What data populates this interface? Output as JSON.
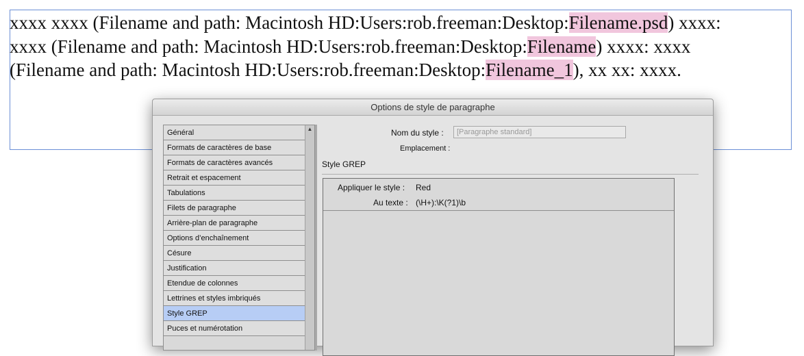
{
  "document": {
    "line1": {
      "text_before": "xxxx xxxx (Filename and path: Macintosh HD:Users:rob.freeman:Desktop:",
      "highlight": "Filename.psd",
      "text_after": ") xxxx:"
    },
    "line2": {
      "text_before": "xxxx (Filename and path: Macintosh HD:Users:rob.freeman:Desktop:",
      "highlight": "Filename",
      "text_after": ") xxxx: xxxx"
    },
    "line3": {
      "text_before": "(Filename and path: Macintosh HD:Users:rob.freeman:Desktop:",
      "highlight": "Filename_1",
      "text_after": "), xx xx: xxxx."
    },
    "highlight_color": "#f1c6dd",
    "frame_color": "#6b8fd6"
  },
  "dialog": {
    "title": "Options de style de paragraphe",
    "categories": [
      {
        "label": "Général"
      },
      {
        "label": "Formats de caractères de base"
      },
      {
        "label": "Formats de caractères avancés"
      },
      {
        "label": "Retrait et espacement"
      },
      {
        "label": "Tabulations"
      },
      {
        "label": "Filets de paragraphe"
      },
      {
        "label": "Arrière-plan de paragraphe"
      },
      {
        "label": "Options d’enchaînement"
      },
      {
        "label": "Césure"
      },
      {
        "label": "Justification"
      },
      {
        "label": "Etendue de colonnes"
      },
      {
        "label": "Lettrines et styles imbriqués"
      },
      {
        "label": "Style GREP"
      },
      {
        "label": "Puces et numérotation"
      }
    ],
    "selected_category": "Style GREP",
    "selected_color": "#b7cdf5",
    "style_name_label": "Nom du style :",
    "style_name_value": "[Paragraphe standard]",
    "location_label": "Emplacement :",
    "section_title": "Style GREP",
    "grep": {
      "apply_style_label": "Appliquer le style :",
      "apply_style_value": "Red",
      "to_text_label": "Au texte :",
      "to_text_value": "(\\H+):\\K(?1)\\b"
    }
  }
}
